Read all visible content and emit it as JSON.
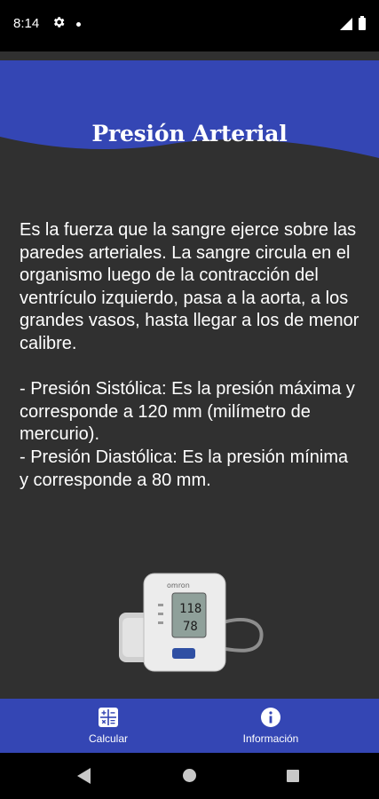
{
  "status_bar": {
    "time": "8:14",
    "icons": [
      "gear-icon",
      "notification-dot-icon",
      "signal-icon",
      "battery-icon"
    ]
  },
  "header": {
    "title": "Presión Arterial",
    "color": "#3446b4"
  },
  "content": {
    "body": "Es la fuerza que la sangre ejerce sobre las paredes arteriales. La sangre circula en el organismo luego de la contracción del ventrículo izquierdo, pasa a la aorta, a los grandes vasos, hasta llegar a los de menor calibre.\n\n- Presión Sistólica: Es la presión máxima y corresponde a 120 mm (milímetro de mercurio).\n- Presión Diastólica: Es la presión mínima y corresponde a 80 mm."
  },
  "device": {
    "brand": "omron",
    "systolic_reading": "118",
    "diastolic_reading": "78"
  },
  "bottom_nav": {
    "items": [
      {
        "label": "Calcular",
        "icon": "calculator-icon"
      },
      {
        "label": "Información",
        "icon": "info-icon"
      }
    ],
    "background": "#3446b4"
  },
  "system_nav": {
    "icons": [
      "back-icon",
      "home-icon",
      "recents-icon"
    ]
  }
}
